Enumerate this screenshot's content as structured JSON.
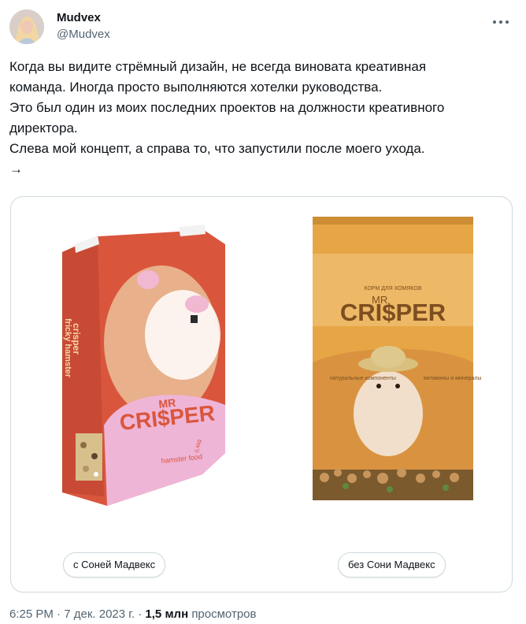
{
  "author": {
    "name": "Mudvex",
    "handle": "@Mudvex"
  },
  "icons": {
    "more": "more-dots-icon",
    "avatar": "avatar"
  },
  "tweet": {
    "text": "Когда вы видите стрёмный дизайн, не всегда виновата креативная\nкоманда. Иногда просто выполняются хотелки руководства.\nЭто был один из моих последних проектов на должности креативного\nдиректора.\nСлева мой концепт, а справа то, что запустили после моего ухода.\n→"
  },
  "media": {
    "left_caption": "с Соней Мадвекс",
    "right_caption": "без Сони Мадвекс",
    "left_pack": {
      "brand_mr": "MR",
      "brand": "CRI$PER",
      "side_text_1": "crisper",
      "side_text_2": "fricky hamster",
      "product_text": "hamster food",
      "weight": "0,4kg"
    },
    "right_pack": {
      "top_label": "КОРМ ДЛЯ ХОМЯКОВ",
      "brand_mr": "MR",
      "brand": "CRI$PER",
      "left_text": "натуральные компоненты",
      "right_text": "витамины и минералы"
    }
  },
  "meta": {
    "time": "6:25 PM",
    "date": "7 дек. 2023 г.",
    "views_count": "1,5 млн",
    "views_label": "просмотров"
  }
}
